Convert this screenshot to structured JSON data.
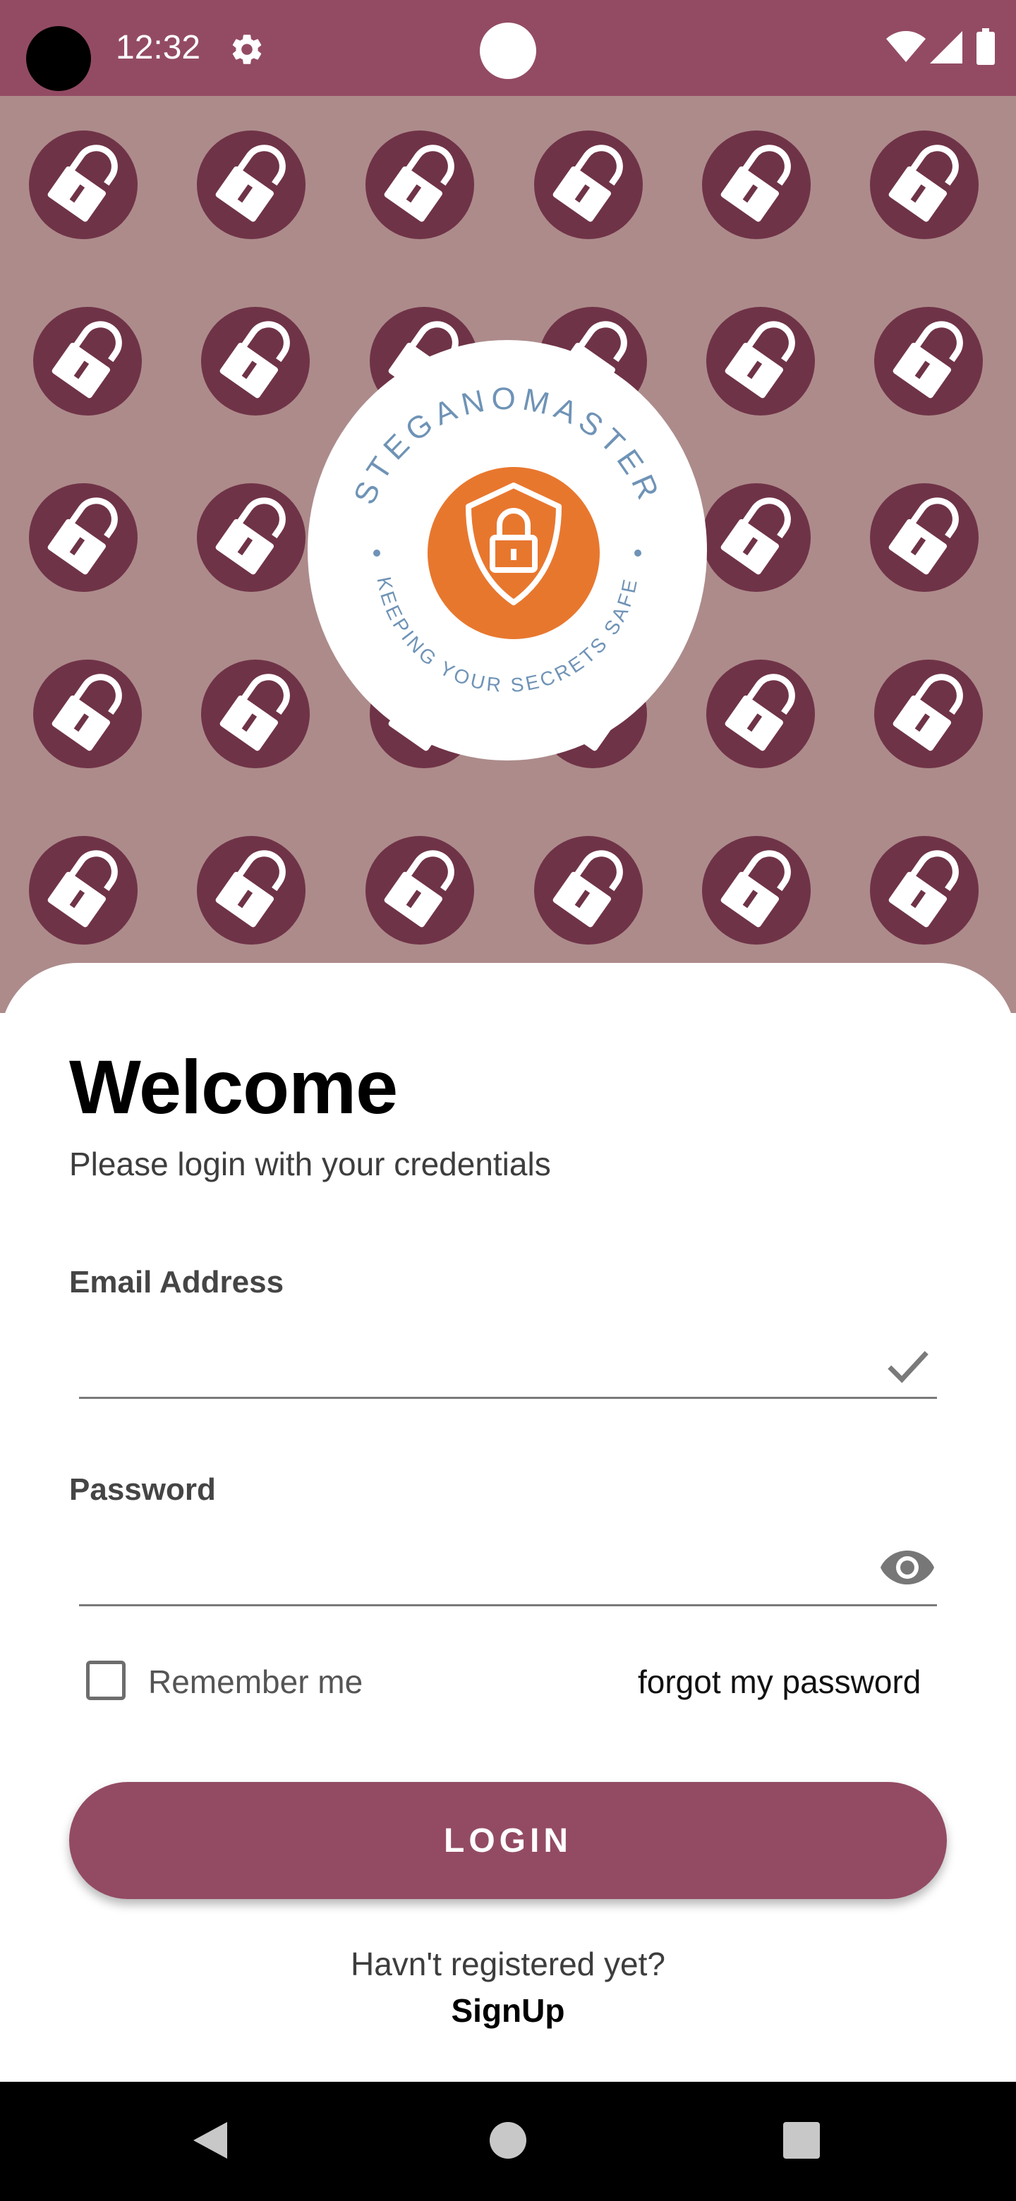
{
  "status_bar": {
    "time": "12:32",
    "background": "#934b63",
    "icons": [
      "camera-hole",
      "gear-icon",
      "wifi-icon",
      "signal-icon",
      "battery-icon"
    ]
  },
  "hero": {
    "background": "#ad8b8b",
    "pattern_icon": "padlock-icon",
    "pattern_color": "#6f3347",
    "logo": {
      "top_text": "STEGANOMASTER",
      "bottom_text": "KEEPING YOUR SECRETS SAFE",
      "emblem_icon": "shield-lock-icon",
      "emblem_color": "#e8772e",
      "text_color": "#6f93b6"
    }
  },
  "login": {
    "title": "Welcome",
    "subtitle": "Please login with your credentials",
    "email": {
      "label": "Email Address",
      "value": "",
      "placeholder": ""
    },
    "password": {
      "label": "Password",
      "value": "",
      "placeholder": ""
    },
    "remember_me": {
      "label": "Remember me",
      "checked": false
    },
    "forgot_password": "forgot my password",
    "login_button": "LOGIN",
    "register_prompt": "Havn't registered yet?",
    "signup_link": "SignUp",
    "accent": "#934b63"
  },
  "nav_bar": {
    "icons": [
      "back-icon",
      "home-icon",
      "recents-icon"
    ]
  }
}
